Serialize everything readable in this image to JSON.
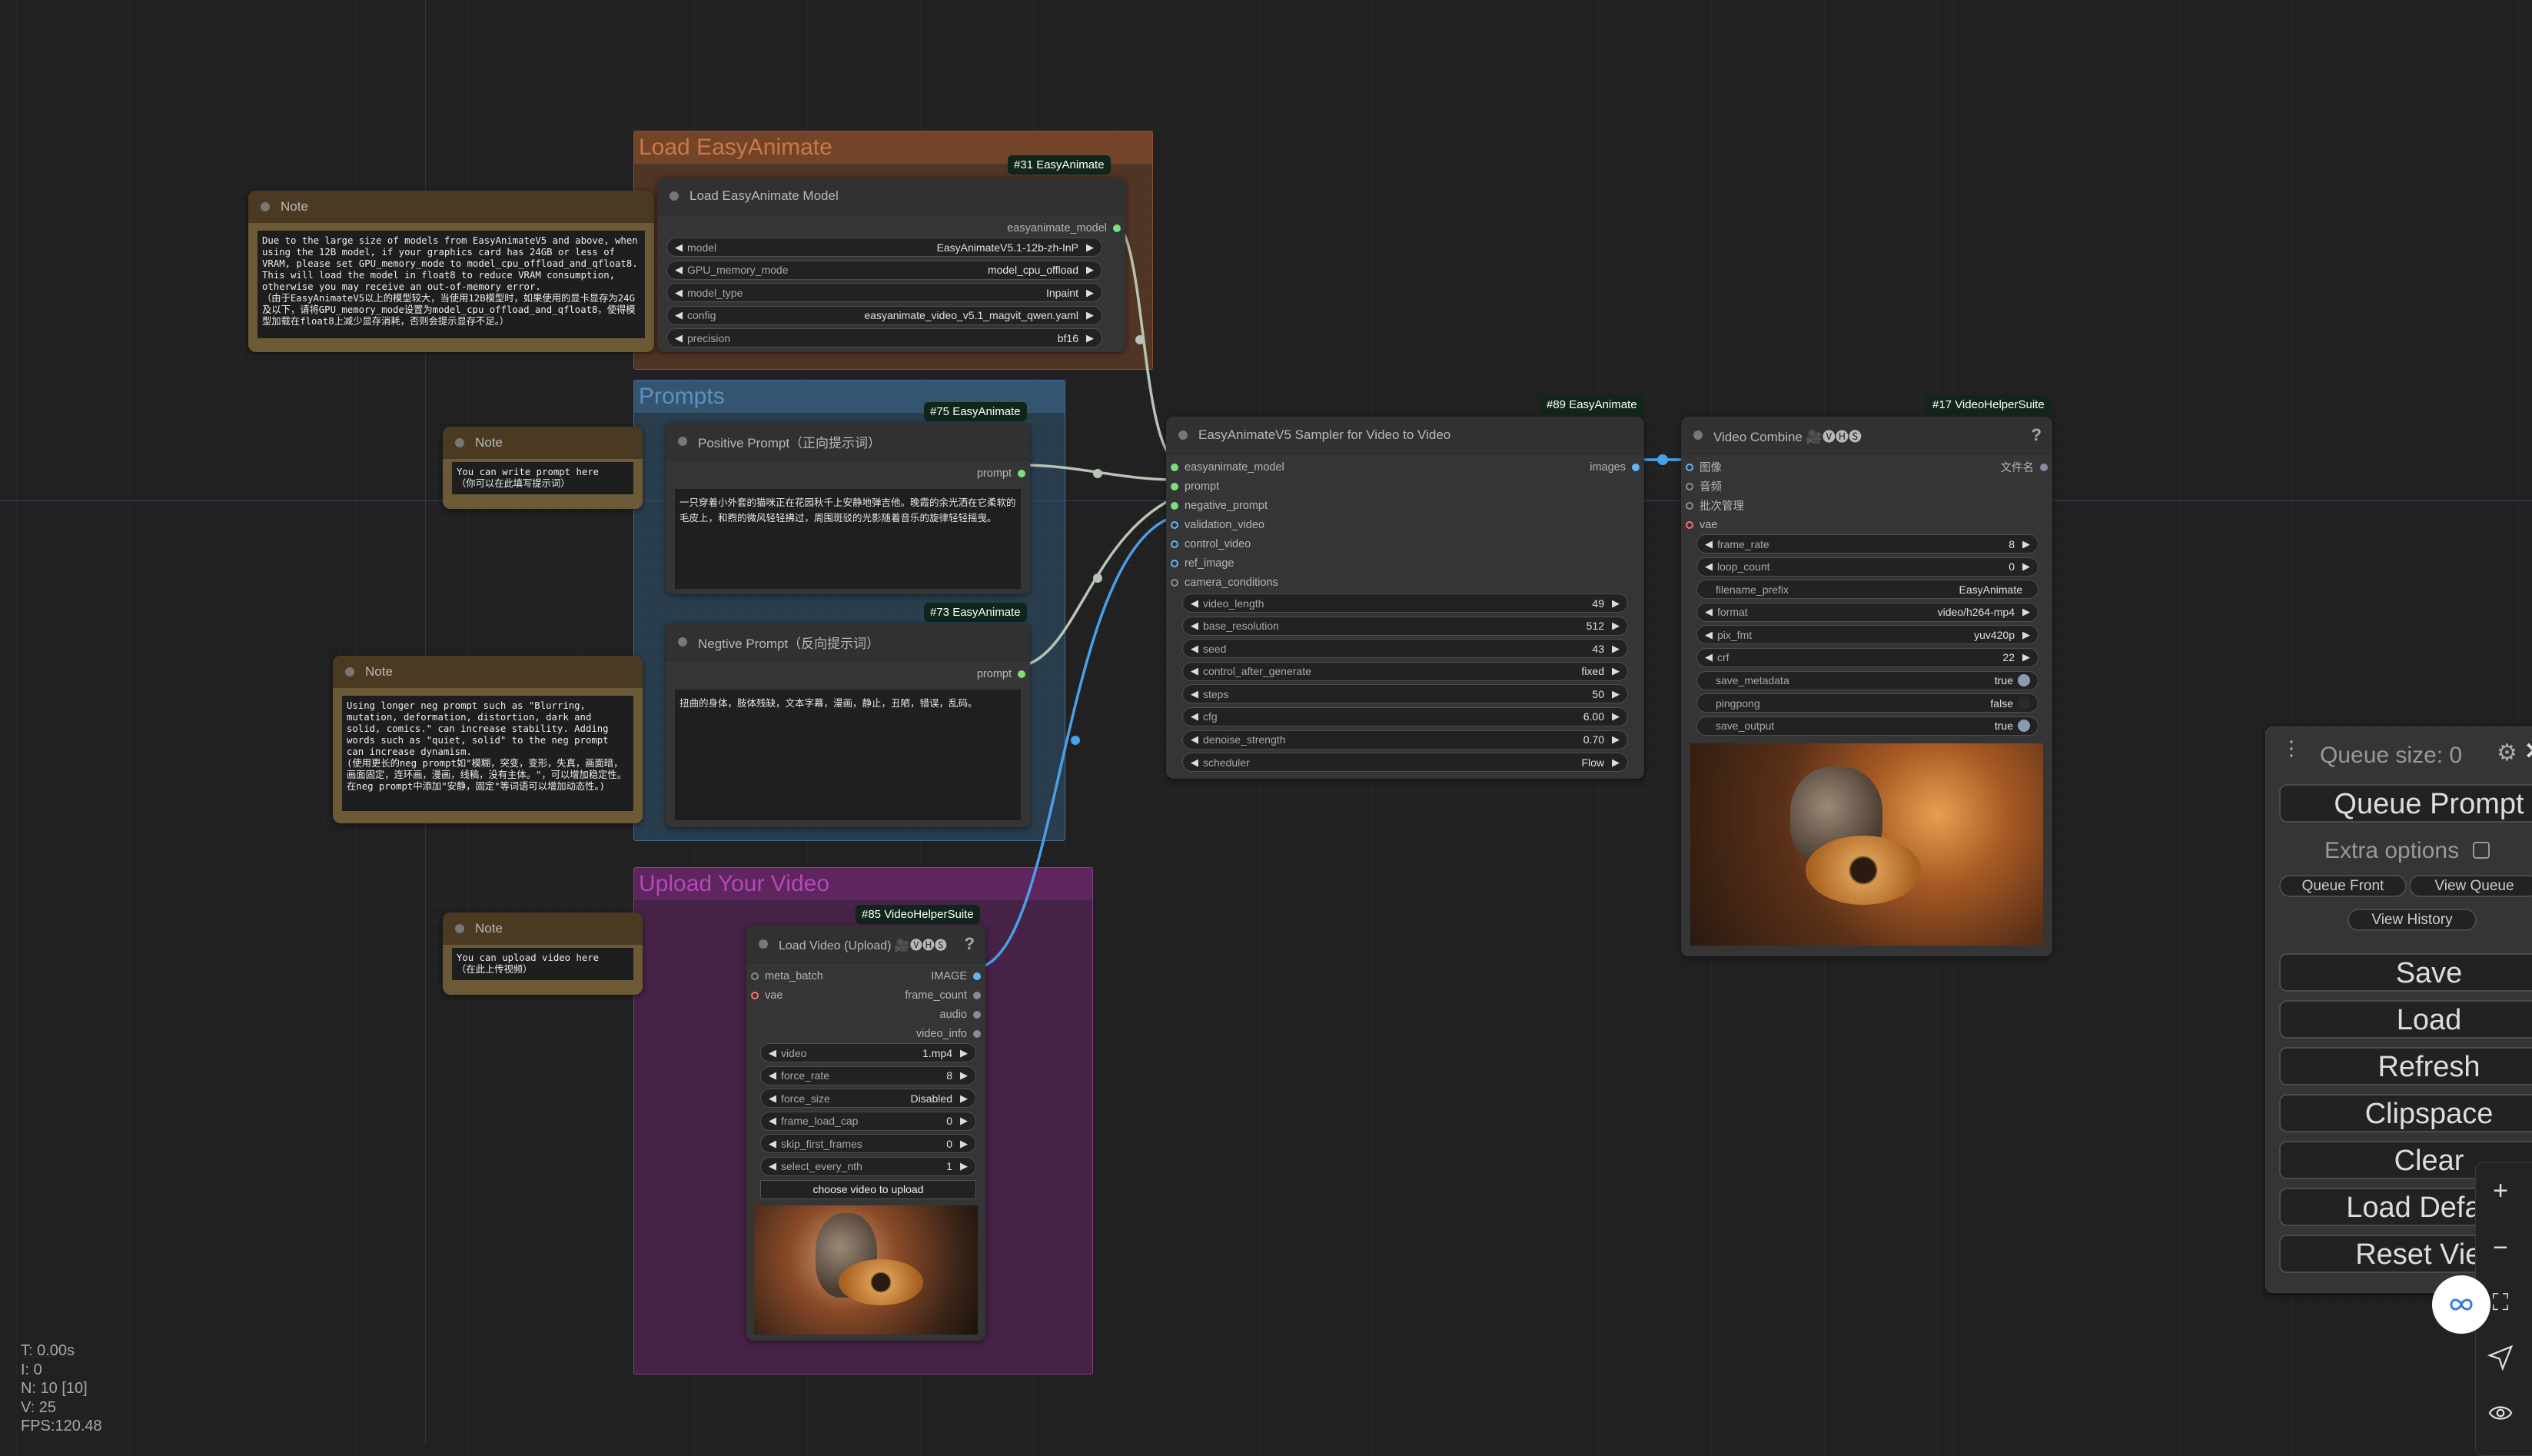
{
  "groups": {
    "load": {
      "title": "Load EasyAnimate",
      "color": "#c8784a"
    },
    "prompts": {
      "title": "Prompts",
      "color": "#5a92c4"
    },
    "upload": {
      "title": "Upload Your Video",
      "color": "#b548b5"
    }
  },
  "notes": [
    {
      "title": "Note",
      "text": "Due to the large size of models from EasyAnimateV5 and above, when using the 12B model, if your graphics card has 24GB or less of VRAM, please set GPU_memory_mode to model_cpu_offload_and_qfloat8. This will load the model in float8 to reduce VRAM consumption, otherwise you may receive an out-of-memory error.\n（由于EasyAnimateV5以上的模型较大，当使用12B模型时，如果使用的显卡显存为24G及以下，请将GPU_memory_mode设置为model_cpu_offload_and_qfloat8，使得模型加载在float8上减少显存消耗，否则会提示显存不足。）"
    },
    {
      "title": "Note",
      "text": "You can write prompt here\n（你可以在此填写提示词）"
    },
    {
      "title": "Note",
      "text": "Using longer neg prompt such as \"Blurring, mutation, deformation, distortion, dark and solid, comics.\" can increase stability. Adding words such as \"quiet, solid\" to the neg prompt can increase dynamism.\n(使用更长的neg prompt如\"模糊，突变，变形，失真，画面暗，画面固定，连环画，漫画，线稿，没有主体。\"，可以增加稳定性。在neg prompt中添加\"安静，固定\"等词语可以增加动态性。)"
    },
    {
      "title": "Note",
      "text": "You can upload video here\n（在此上传视频）"
    }
  ],
  "nodes": {
    "load_model": {
      "badge": "#31 EasyAnimate",
      "title": "Load EasyAnimate Model",
      "outputs": [
        {
          "label": "easyanimate_model",
          "color": "#7be07b"
        }
      ],
      "widgets": [
        {
          "label": "model",
          "value": "EasyAnimateV5.1-12b-zh-InP"
        },
        {
          "label": "GPU_memory_mode",
          "value": "model_cpu_offload"
        },
        {
          "label": "model_type",
          "value": "Inpaint"
        },
        {
          "label": "config",
          "value": "easyanimate_video_v5.1_magvit_qwen.yaml"
        },
        {
          "label": "precision",
          "value": "bf16"
        }
      ]
    },
    "positive": {
      "badge": "#75 EasyAnimate",
      "title": "Positive Prompt（正向提示词）",
      "outputs": [
        {
          "label": "prompt",
          "color": "#7be07b"
        }
      ],
      "text": "一只穿着小外套的猫咪正在花园秋千上安静地弹吉他。晚霞的余光洒在它柔软的毛皮上，和煦的微风轻轻拂过，周围斑驳的光影随着音乐的旋律轻轻摇曳。"
    },
    "negative": {
      "badge": "#73 EasyAnimate",
      "title": "Negtive Prompt（反向提示词）",
      "outputs": [
        {
          "label": "prompt",
          "color": "#7be07b"
        }
      ],
      "text": "扭曲的身体，肢体残缺，文本字幕，漫画，静止，丑陋，错误，乱码。"
    },
    "sampler": {
      "badge": "#89 EasyAnimate",
      "title": "EasyAnimateV5 Sampler for Video to Video",
      "inputs": [
        {
          "label": "easyanimate_model",
          "color": "#7be07b"
        },
        {
          "label": "prompt",
          "color": "#7be07b"
        },
        {
          "label": "negative_prompt",
          "color": "#7be07b"
        },
        {
          "label": "validation_video",
          "color": "#64b5f6"
        },
        {
          "label": "control_video",
          "color": "#64b5f6"
        },
        {
          "label": "ref_image",
          "color": "#64b5f6"
        },
        {
          "label": "camera_conditions",
          "color": "#8a8a9a"
        }
      ],
      "outputs": [
        {
          "label": "images",
          "color": "#64b5f6"
        }
      ],
      "widgets": [
        {
          "label": "video_length",
          "value": "49"
        },
        {
          "label": "base_resolution",
          "value": "512"
        },
        {
          "label": "seed",
          "value": "43"
        },
        {
          "label": "control_after_generate",
          "value": "fixed"
        },
        {
          "label": "steps",
          "value": "50"
        },
        {
          "label": "cfg",
          "value": "6.00"
        },
        {
          "label": "denoise_strength",
          "value": "0.70"
        },
        {
          "label": "scheduler",
          "value": "Flow"
        }
      ]
    },
    "video_combine": {
      "badge": "#17 VideoHelperSuite",
      "title": "Video Combine 🎥🅥🅗🅢",
      "help": "?",
      "inputs": [
        {
          "label": "图像",
          "color": "#64b5f6"
        },
        {
          "label": "音频",
          "color": "#8a8a9a"
        },
        {
          "label": "批次管理",
          "color": "#8a8a9a"
        },
        {
          "label": "vae",
          "color": "#ff6e6e"
        }
      ],
      "outputs": [
        {
          "label": "文件名",
          "color": "#8a8a9a"
        }
      ],
      "widgets": [
        {
          "label": "frame_rate",
          "value": "8"
        },
        {
          "label": "loop_count",
          "value": "0"
        },
        {
          "label": "filename_prefix",
          "value": "EasyAnimate",
          "kind": "text"
        },
        {
          "label": "format",
          "value": "video/h264-mp4"
        },
        {
          "label": "pix_fmt",
          "value": "yuv420p"
        },
        {
          "label": "crf",
          "value": "22"
        },
        {
          "label": "save_metadata",
          "value": "true",
          "kind": "toggle",
          "on": true
        },
        {
          "label": "pingpong",
          "value": "false",
          "kind": "toggle",
          "on": false
        },
        {
          "label": "save_output",
          "value": "true",
          "kind": "toggle",
          "on": true
        }
      ]
    },
    "load_video": {
      "badge": "#85 VideoHelperSuite",
      "title": "Load Video (Upload) 🎥🅥🅗🅢",
      "help": "?",
      "inputs": [
        {
          "label": "meta_batch",
          "color": "#8a8a9a"
        },
        {
          "label": "vae",
          "color": "#ff6e6e"
        }
      ],
      "outputs": [
        {
          "label": "IMAGE",
          "color": "#64b5f6"
        },
        {
          "label": "frame_count",
          "color": "#8a8a9a"
        },
        {
          "label": "audio",
          "color": "#8a8a9a"
        },
        {
          "label": "video_info",
          "color": "#8a8a9a"
        }
      ],
      "widgets": [
        {
          "label": "video",
          "value": "1.mp4"
        },
        {
          "label": "force_rate",
          "value": "8"
        },
        {
          "label": "force_size",
          "value": "Disabled"
        },
        {
          "label": "frame_load_cap",
          "value": "0"
        },
        {
          "label": "skip_first_frames",
          "value": "0"
        },
        {
          "label": "select_every_nth",
          "value": "1"
        }
      ],
      "upload_button": "choose video to upload"
    }
  },
  "queue_panel": {
    "queue_size": "Queue size: 0",
    "queue_prompt": "Queue Prompt",
    "extra_options": "Extra options",
    "extra_options_checked": false,
    "queue_front": "Queue Front",
    "view_queue": "View Queue",
    "view_history": "View History",
    "buttons": [
      "Save",
      "Load",
      "Refresh",
      "Clipspace",
      "Clear",
      "Load Default",
      "Reset View"
    ]
  },
  "toolbar": [
    "zoom-in-icon",
    "zoom-out-icon",
    "fit-view-icon",
    "send-icon",
    "eye-icon"
  ],
  "stats": {
    "t": "T: 0.00s",
    "i": "I: 0",
    "n": "N: 10 [10]",
    "v": "V: 25",
    "fps": "FPS:120.48"
  },
  "link_colors": {
    "model": "#b8c4b4",
    "prompt": "#b8c4b4",
    "image": "#4aa0e8"
  }
}
